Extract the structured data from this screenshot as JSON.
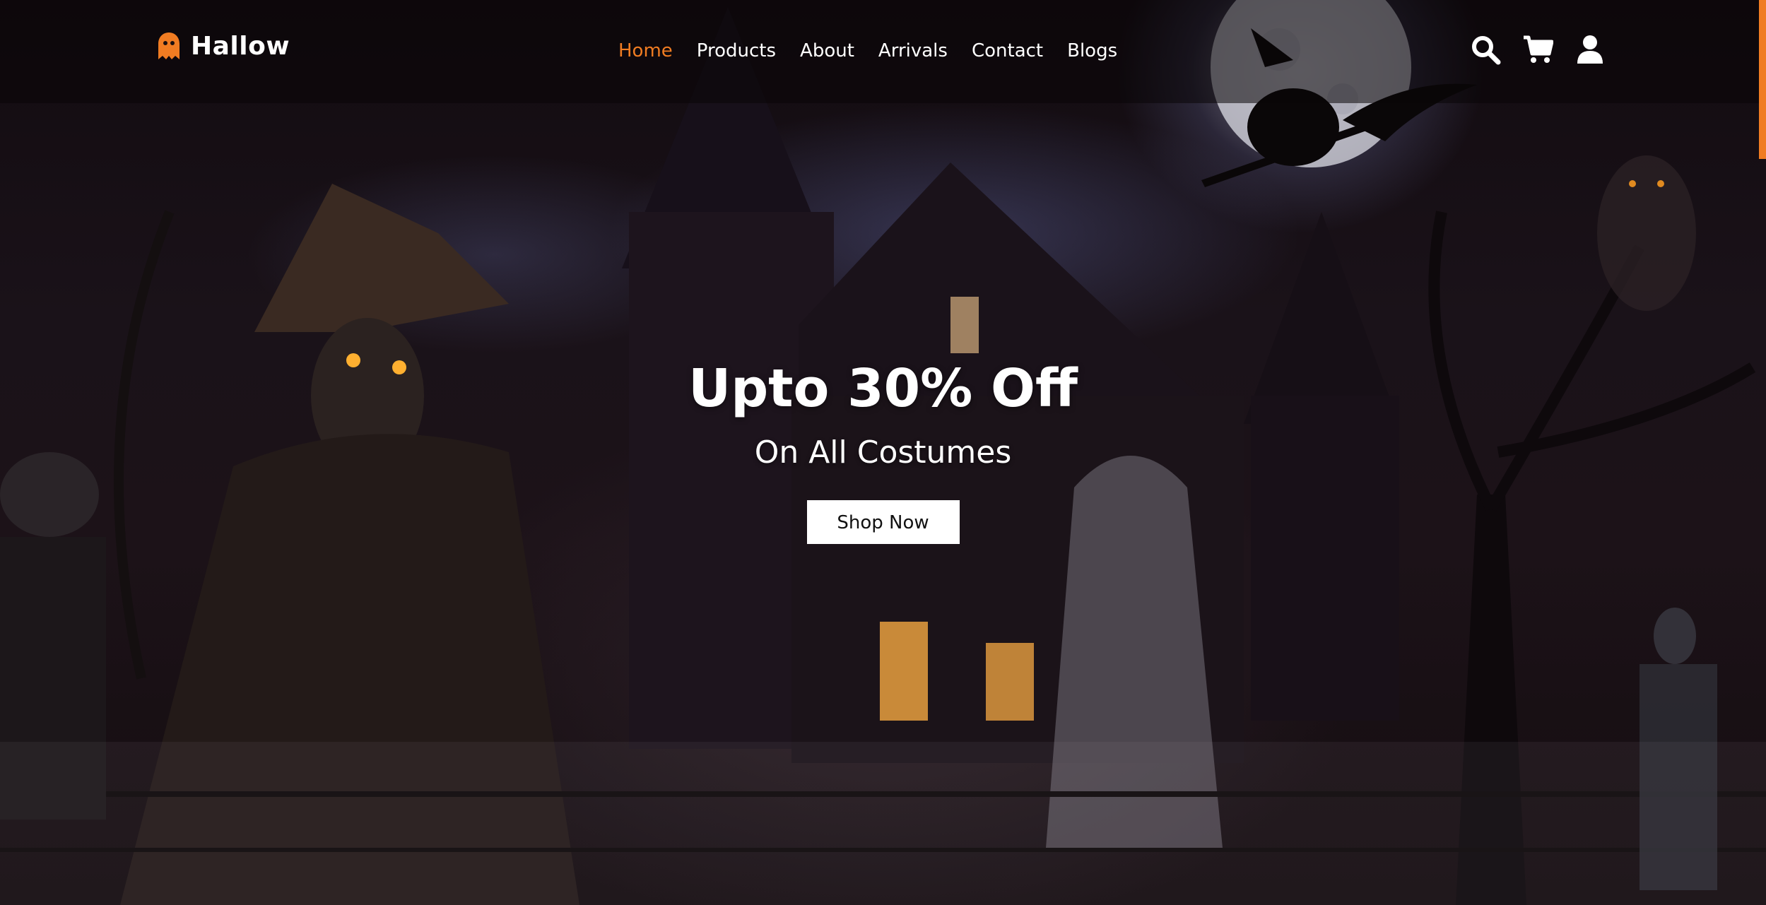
{
  "brand": {
    "name": "Hallow",
    "logo_icon": "ghost-icon",
    "accent_color": "#f07c22"
  },
  "nav": {
    "items": [
      {
        "label": "Home",
        "active": true
      },
      {
        "label": "Products",
        "active": false
      },
      {
        "label": "About",
        "active": false
      },
      {
        "label": "Arrivals",
        "active": false
      },
      {
        "label": "Contact",
        "active": false
      },
      {
        "label": "Blogs",
        "active": false
      }
    ]
  },
  "header_icons": [
    "search-icon",
    "cart-icon",
    "user-icon"
  ],
  "hero": {
    "title": "Upto 30% Off",
    "subtitle": "On All Costumes",
    "cta_label": "Shop Now"
  }
}
